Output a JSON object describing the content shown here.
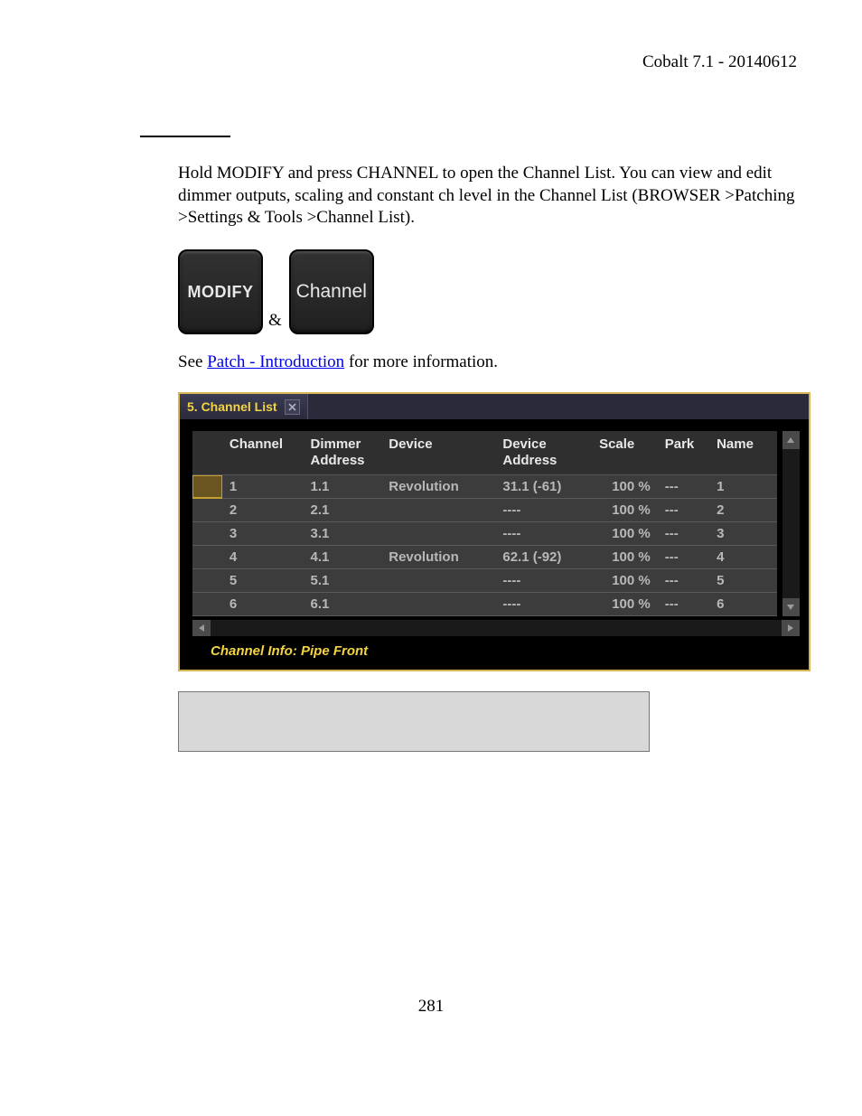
{
  "header": {
    "title": "Cobalt 7.1 - 20140612"
  },
  "intro_paragraph": "Hold MODIFY and press CHANNEL to open the Channel List. You can view and edit dimmer outputs, scaling and constant ch level in the Channel List (BROWSER >Patching >Settings & Tools >Channel List).",
  "keys": {
    "modify_label": "MODIFY",
    "channel_label": "Channel",
    "ampersand": "&"
  },
  "see_line_prefix": "See ",
  "see_link_text": "Patch - Introduction",
  "see_line_suffix": " for more information.",
  "panel": {
    "tab_title": "5. Channel List"
  },
  "columns": {
    "gutter": "",
    "channel": "Channel",
    "dimmer": "Dimmer Address",
    "device": "Device",
    "devaddr": "Device Address",
    "scale": "Scale",
    "park": "Park",
    "name": "Name"
  },
  "rows": [
    {
      "selected": true,
      "channel": "1",
      "dimmer": "1.1",
      "device": "Revolution",
      "devaddr": "31.1 (-61)",
      "scale": "100 %",
      "park": "---",
      "name": "1"
    },
    {
      "selected": false,
      "channel": "2",
      "dimmer": "2.1",
      "device": "",
      "devaddr": "----",
      "scale": "100 %",
      "park": "---",
      "name": "2"
    },
    {
      "selected": false,
      "channel": "3",
      "dimmer": "3.1",
      "device": "",
      "devaddr": "----",
      "scale": "100 %",
      "park": "---",
      "name": "3"
    },
    {
      "selected": false,
      "channel": "4",
      "dimmer": "4.1",
      "device": "Revolution",
      "devaddr": "62.1 (-92)",
      "scale": "100 %",
      "park": "---",
      "name": "4"
    },
    {
      "selected": false,
      "channel": "5",
      "dimmer": "5.1",
      "device": "",
      "devaddr": "----",
      "scale": "100 %",
      "park": "---",
      "name": "5"
    },
    {
      "selected": false,
      "channel": "6",
      "dimmer": "6.1",
      "device": "",
      "devaddr": "----",
      "scale": "100 %",
      "park": "---",
      "name": "6"
    }
  ],
  "channel_info": "Channel Info:  Pipe Front",
  "page_number": "281"
}
